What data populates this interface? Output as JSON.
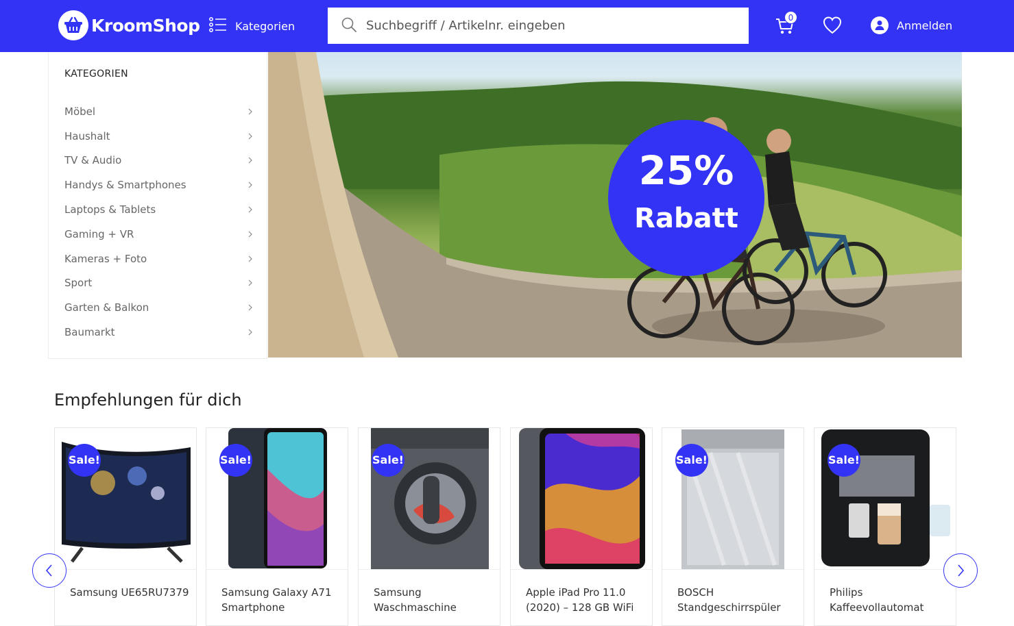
{
  "header": {
    "logo_text": "KroomShop",
    "categories_label": "Kategorien",
    "search_placeholder": "Suchbegriff / Artikelnr. eingeben",
    "cart_count": "0",
    "login_label": "Anmelden",
    "brand_color": "#3333f5"
  },
  "sidebar": {
    "title": "KATEGORIEN",
    "items": [
      {
        "label": "Möbel"
      },
      {
        "label": "Haushalt"
      },
      {
        "label": "TV & Audio"
      },
      {
        "label": "Handys & Smartphones"
      },
      {
        "label": "Laptops & Tablets"
      },
      {
        "label": "Gaming + VR"
      },
      {
        "label": "Kameras + Foto"
      },
      {
        "label": "Sport"
      },
      {
        "label": "Garten & Balkon"
      },
      {
        "label": "Baumarkt"
      }
    ]
  },
  "hero": {
    "badge_percent": "25%",
    "badge_word": "Rabatt"
  },
  "recommendations": {
    "title": "Empfehlungen für dich",
    "sale_label": "Sale!",
    "products": [
      {
        "name": "Samsung UE65RU7379",
        "sale": true,
        "icon": "tv-icon"
      },
      {
        "name": "Samsung Galaxy A71 Smartphone",
        "sale": true,
        "icon": "smartphone-icon"
      },
      {
        "name": "Samsung Waschmaschine",
        "sale": true,
        "icon": "washing-machine-icon"
      },
      {
        "name": "Apple iPad Pro 11.0 (2020) – 128 GB WiFi",
        "sale": false,
        "icon": "tablet-icon"
      },
      {
        "name": "BOSCH Standgeschirrspüler",
        "sale": true,
        "icon": "dishwasher-icon"
      },
      {
        "name": "Philips Kaffeevollautomat",
        "sale": true,
        "icon": "coffee-machine-icon"
      }
    ]
  }
}
